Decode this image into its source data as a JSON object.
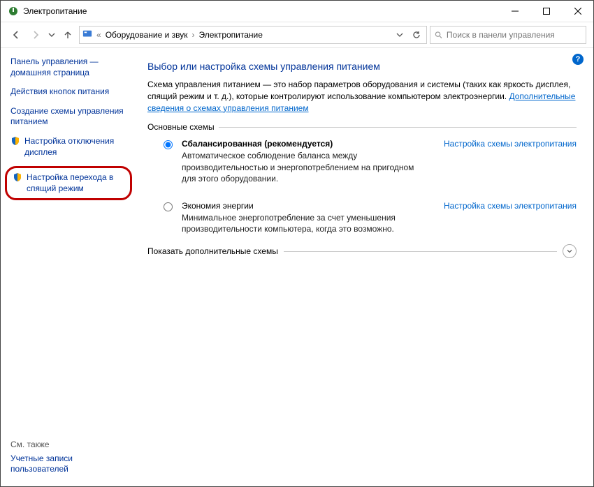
{
  "window": {
    "title": "Электропитание"
  },
  "breadcrumb": {
    "item0": "Оборудование и звук",
    "item1": "Электропитание"
  },
  "search": {
    "placeholder": "Поиск в панели управления"
  },
  "sidebar": {
    "home": "Панель управления — домашняя страница",
    "actions": "Действия кнопок питания",
    "create_plan": "Создание схемы управления питанием",
    "display_off": "Настройка отключения дисплея",
    "sleep": "Настройка перехода в спящий режим",
    "see_also": "См. также",
    "user_accounts": "Учетные записи пользователей"
  },
  "main": {
    "title": "Выбор или настройка схемы управления питанием",
    "intro_1": "Схема управления питанием — это набор параметров оборудования и системы (таких как яркость дисплея, спящий режим и т. д.), которые контролируют использование компьютером электроэнергии. ",
    "intro_link": "Дополнительные сведения о схемах управления питанием",
    "section_main": "Основные схемы",
    "plan_settings_link": "Настройка схемы электропитания",
    "balanced": {
      "title": "Сбалансированная (рекомендуется)",
      "desc": "Автоматическое соблюдение баланса между производительностью и энергопотреблением на пригодном для этого оборудовании."
    },
    "saver": {
      "title": "Экономия энергии",
      "desc": "Минимальное энергопотребление за счет уменьшения производительности компьютера, когда это возможно."
    },
    "show_more": "Показать дополнительные схемы"
  }
}
